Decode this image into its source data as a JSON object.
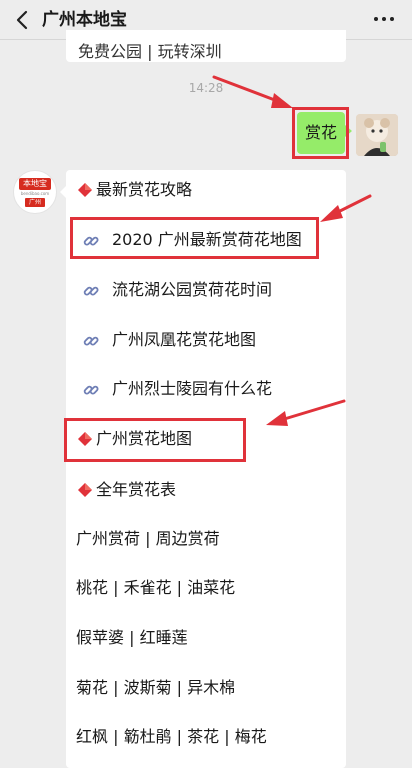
{
  "header": {
    "title": "广州本地宝"
  },
  "chat": {
    "prev_card_text": "免费公园 | 玩转深圳",
    "timestamp": "14:28",
    "user_message": "赏花",
    "bot_avatar": {
      "brand": "本地宝",
      "site": "bendibao.com",
      "city": "广州"
    },
    "card": {
      "section1_title": "最新赏花攻略",
      "links": [
        "2020 广州最新赏荷花地图",
        "流花湖公园赏荷花时间",
        "广州凤凰花赏花地图",
        "广州烈士陵园有什么花"
      ],
      "section2_title": "广州赏花地图",
      "section3_title": "全年赏花表",
      "rows": [
        "广州赏荷 | 周边赏荷",
        "桃花 | 禾雀花 | 油菜花",
        "假苹婆 | 红睡莲",
        "菊花 |  波斯菊 | 异木棉",
        "红枫 | 簕杜鹃 | 茶花 | 梅花"
      ]
    }
  },
  "icons": {
    "back": "chevron-left-icon",
    "more": "more-dots-icon",
    "link": "link-icon",
    "diamond": "red-diamond-icon"
  },
  "colors": {
    "background": "#ededed",
    "bubble": "#95ec69",
    "annotation": "#e0323a",
    "link_icon": "#6f7fb5",
    "diamond": "#e0323a"
  }
}
